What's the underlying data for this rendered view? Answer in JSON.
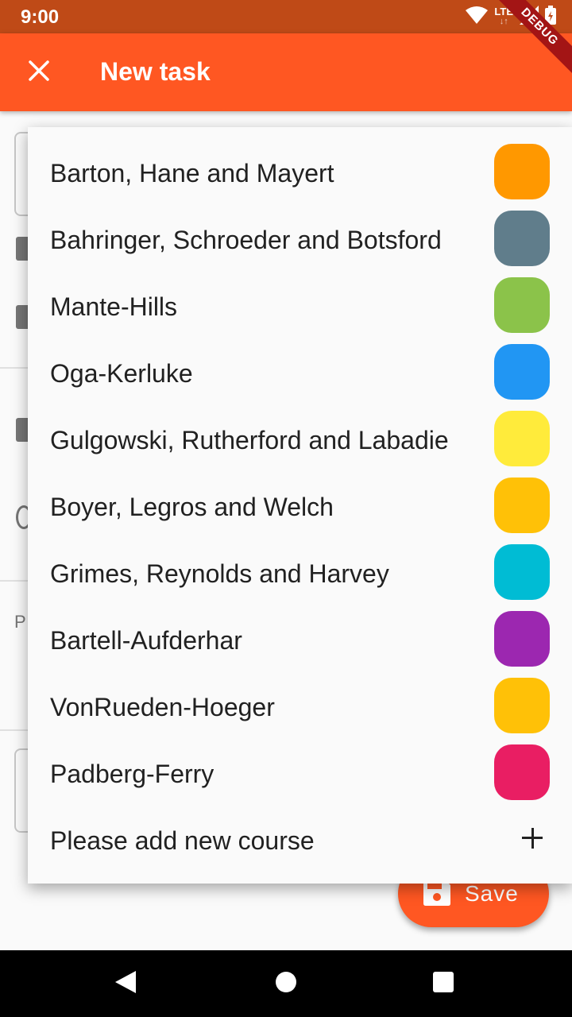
{
  "status_bar": {
    "time": "9:00",
    "network": "LTE"
  },
  "debug_banner": "DEBUG",
  "app_bar": {
    "title": "New task",
    "close_icon": "close-icon"
  },
  "background_form": {
    "partial_label": "P"
  },
  "save_button": {
    "label": "Save",
    "icon": "save-icon"
  },
  "course_menu": {
    "items": [
      {
        "name": "Barton, Hane and Mayert",
        "color": "#ff9800"
      },
      {
        "name": "Bahringer, Schroeder and Botsford",
        "color": "#607d8b"
      },
      {
        "name": "Mante-Hills",
        "color": "#8bc34a"
      },
      {
        "name": "Oga-Kerluke",
        "color": "#2196f3"
      },
      {
        "name": "Gulgowski, Rutherford and Labadie",
        "color": "#ffeb3b"
      },
      {
        "name": "Boyer, Legros and Welch",
        "color": "#ffc107"
      },
      {
        "name": "Grimes, Reynolds and Harvey",
        "color": "#00bcd4"
      },
      {
        "name": "Bartell-Aufderhar",
        "color": "#9c27b0"
      },
      {
        "name": "VonRueden-Hoeger",
        "color": "#ffc107"
      },
      {
        "name": "Padberg-Ferry",
        "color": "#e91e63"
      }
    ],
    "add_label": "Please add new course"
  }
}
